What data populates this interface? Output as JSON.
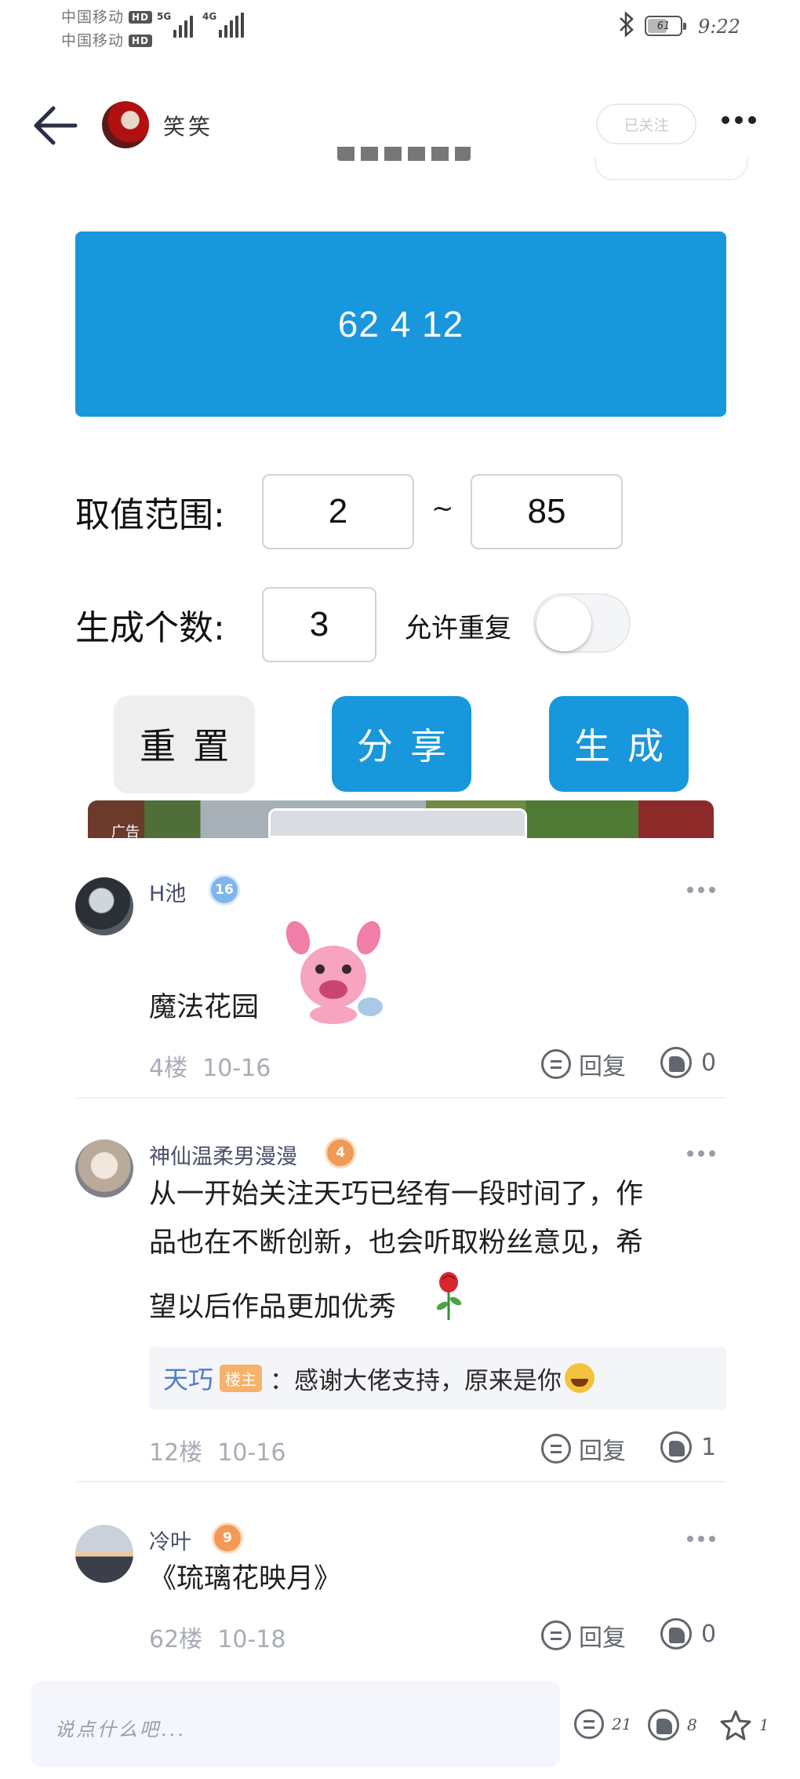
{
  "status_bar": {
    "carrier_1": "中国移动",
    "carrier_2": "中国移动",
    "hd_badge": "HD",
    "net_1": "5G",
    "net_2": "4G",
    "battery_level": 61,
    "battery_text": "61",
    "time": "9:22"
  },
  "header": {
    "author_name": "笑笑",
    "follow_label": "已关注"
  },
  "generator": {
    "result": "62 4 12",
    "range_label": "取值范围:",
    "range_min": "2",
    "range_tilde": "~",
    "range_max": "85",
    "count_label": "生成个数:",
    "count": "3",
    "allow_repeat_label": "允许重复",
    "allow_repeat_on": false,
    "reset_label": "重置",
    "share_label": "分享",
    "generate_label": "生成",
    "ad_label": "广告"
  },
  "comments": [
    {
      "name": "H池",
      "level": "16",
      "text": "魔法花园",
      "floor": "4楼",
      "date": "10-16",
      "reply_label": "回复",
      "likes": "0"
    },
    {
      "name": "神仙温柔男漫漫",
      "level": "4",
      "text_line_1": "从一开始关注天巧已经有一段时间了，作",
      "text_line_2": "品也在不断创新，也会听取粉丝意见，希",
      "text_line_3": "望以后作品更加优秀",
      "sub_reply": {
        "name": "天巧",
        "tag": "楼主",
        "separator": "：",
        "text": "感谢大佬支持，原来是你"
      },
      "floor": "12楼",
      "date": "10-16",
      "reply_label": "回复",
      "likes": "1"
    },
    {
      "name": "冷叶",
      "level": "9",
      "text": "《琉璃花映月》",
      "floor": "62楼",
      "date": "10-18",
      "reply_label": "回复",
      "likes": "0"
    }
  ],
  "bottom_bar": {
    "input_placeholder": "说点什么吧...",
    "comment_count": "21",
    "like_count": "8",
    "star_count": "1"
  },
  "colors": {
    "accent_blue": "#1997dc",
    "name_color": "#4a4f6b",
    "meta_gray": "#a8acb5"
  }
}
